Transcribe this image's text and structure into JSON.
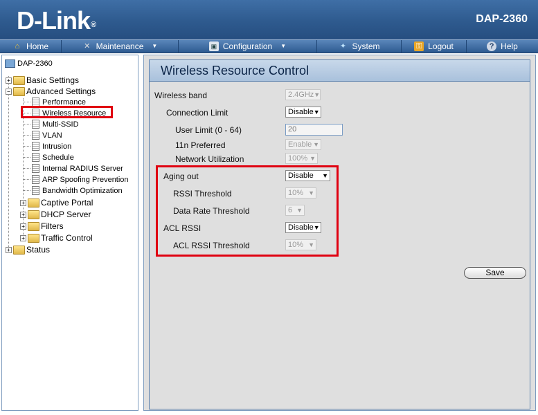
{
  "header": {
    "logo": "D-Link",
    "logo_mark": "®",
    "model": "DAP-2360"
  },
  "menu": {
    "home": "Home",
    "maintenance": "Maintenance",
    "configuration": "Configuration",
    "system": "System",
    "logout": "Logout",
    "help": "Help"
  },
  "tree": {
    "root": "DAP-2360",
    "basic_settings": "Basic Settings",
    "advanced_settings": "Advanced Settings",
    "performance": "Performance",
    "wireless_resource": "Wireless Resource",
    "multi_ssid": "Multi-SSID",
    "vlan": "VLAN",
    "intrusion": "Intrusion",
    "schedule": "Schedule",
    "internal_radius": "Internal RADIUS Server",
    "arp_spoofing": "ARP Spoofing Prevention",
    "bandwidth_opt": "Bandwidth Optimization",
    "captive_portal": "Captive Portal",
    "dhcp_server": "DHCP Server",
    "filters": "Filters",
    "traffic_control": "Traffic Control",
    "status": "Status"
  },
  "panel": {
    "title": "Wireless Resource Control",
    "wireless_band": {
      "label": "Wireless band",
      "value": "2.4GHz"
    },
    "connection_limit": {
      "label": "Connection Limit",
      "value": "Disable"
    },
    "user_limit": {
      "label": "User Limit (0 - 64)",
      "value": "20"
    },
    "n11_preferred": {
      "label": "11n Preferred",
      "value": "Enable"
    },
    "network_utilization": {
      "label": "Network Utilization",
      "value": "100%"
    },
    "aging_out": {
      "label": "Aging out",
      "value": "Disable"
    },
    "rssi_threshold": {
      "label": "RSSI Threshold",
      "value": "10%"
    },
    "data_rate_threshold": {
      "label": "Data Rate Threshold",
      "value": "6"
    },
    "acl_rssi": {
      "label": "ACL RSSI",
      "value": "Disable"
    },
    "acl_rssi_threshold": {
      "label": "ACL RSSI Threshold",
      "value": "10%"
    },
    "save_label": "Save"
  },
  "colors": {
    "header_bg": "#2e5a8e",
    "highlight": "#e00010",
    "panel_bg": "#dfdfdf"
  }
}
